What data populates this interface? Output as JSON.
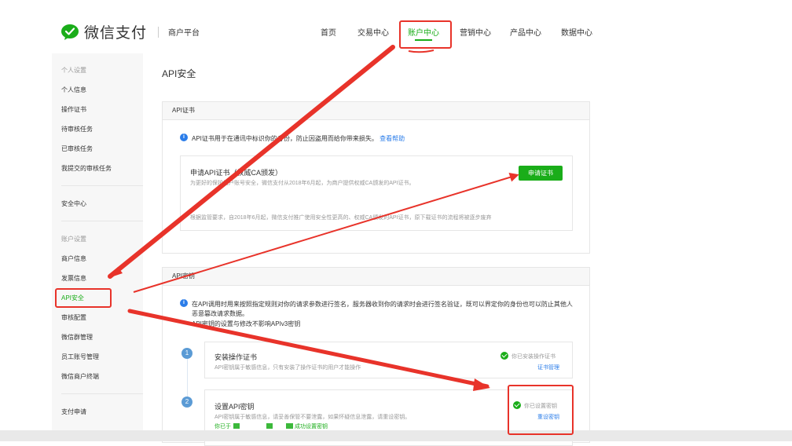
{
  "header": {
    "brand": "微信支付",
    "platform": "商户平台",
    "nav": [
      "首页",
      "交易中心",
      "账户中心",
      "营销中心",
      "产品中心",
      "数据中心"
    ],
    "active_nav": "账户中心"
  },
  "sidebar": {
    "group1": "个人设置",
    "group1_items": [
      "个人信息",
      "操作证书",
      "待审核任务",
      "已审核任务",
      "我提交的审核任务"
    ],
    "security": "安全中心",
    "group2": "账户设置",
    "group2_items": [
      "商户信息",
      "发票信息",
      "API安全",
      "审核配置",
      "微信群管理",
      "员工账号管理",
      "微信商户终端"
    ],
    "active_item": "API安全",
    "pay_apply": "支付申请"
  },
  "main": {
    "title": "API安全",
    "cert": {
      "section_title": "API证书",
      "notice": "API证书用于在通讯中标识你的身份，防止因盗用而给你带来损失。",
      "help_link": "查看帮助",
      "card_title": "申请API证书（权威CA颁发）",
      "card_desc": "为更好的保护用户账号安全，微信支付从2018年6月起，为商户提供权威CA颁发的API证书。",
      "card_note": "根据监管要求，自2018年6月起，微信支付推广使用安全性更高的、权威CA颁发的API证书，原下载证书的流程将被逐步废弃",
      "apply_button": "申请证书"
    },
    "key": {
      "section_title": "API密钥",
      "notice_line1": "在API调用时用来按照指定规则对你的请求参数进行签名，服务器收到你的请求时会进行签名验证，既可以界定你的身份也可以防止其他人",
      "notice_line2": "恶意篡改请求数据。",
      "notice_line3": "API密钥的设置与修改不影响APIv3密钥",
      "steps": [
        {
          "num": "1",
          "title": "安装操作证书",
          "desc": "API密钥属于敏感信息，只有安装了操作证书的用户才能操作",
          "status": "你已安装操作证书",
          "action": "证书管理"
        },
        {
          "num": "2",
          "title": "设置API密钥",
          "desc": "API密钥属于敏感信息，请妥善保管不要泄露，如果怀疑信息泄露，请重设密钥。",
          "extra": "你已于",
          "extra_tail": "成功设置密钥",
          "status": "你已设置密钥",
          "action": "重设密钥"
        }
      ]
    }
  },
  "colors": {
    "accent": "#1aad19",
    "link": "#2b7de9",
    "annotation": "#e8332a"
  }
}
